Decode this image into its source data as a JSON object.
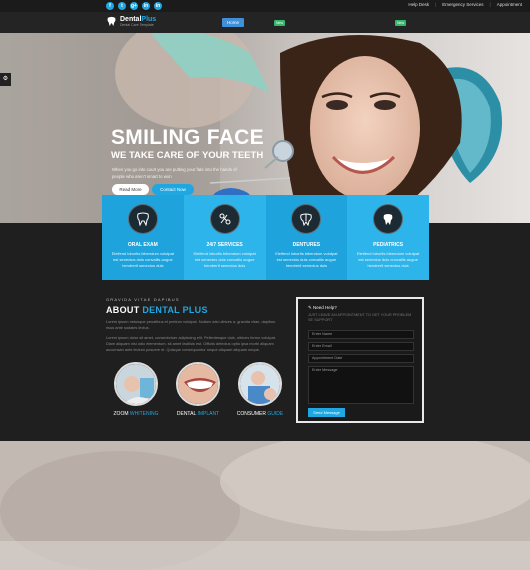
{
  "topbar": {
    "socials": [
      "f",
      "t",
      "g+",
      "in",
      "in"
    ],
    "links": [
      "Help Desk",
      "Emergency Services",
      "Appointment"
    ]
  },
  "brand": {
    "name_a": "Dental",
    "name_b": "Plus",
    "tagline": "Dental Care Template"
  },
  "nav": {
    "items": [
      "Home",
      "",
      "",
      "",
      "",
      "",
      ""
    ],
    "badges": [
      "New",
      "New"
    ]
  },
  "hero": {
    "side_button": "",
    "title": "SMILING FACE",
    "subtitle": "WE TAKE CARE OF YOUR TEETH",
    "description": "When you go into court you are putting your fate into the hands of people who aren't smart to won",
    "read_more": "Read More",
    "contact_now": "Contact Now"
  },
  "services": [
    {
      "title": "ORAL EXAM",
      "text": "Eleifend lobortis bibendum volutpat est senectus duis convallis augue hendrerit senectus duis"
    },
    {
      "title": "24/7 SERVICES",
      "text": "Eleifend lobortis bibendum volutpat est senectus duis convallis augue hendrerit senectus duis"
    },
    {
      "title": "DENTURES",
      "text": "Eleifend lobortis bibendum volutpat est senectus duis convallis augue hendrerit senectus duis"
    },
    {
      "title": "PEDIATRICS",
      "text": "Eleifend lobortis bibendum volutpat est senectus duis convallis augue hendrerit senectus duis"
    }
  ],
  "about": {
    "kicker": "GRAVIDA VITAE DAPIBUS",
    "title_a": "ABOUT ",
    "title_b": "DENTAL PLUS",
    "p1": "Lorem ipsum netusque penatibus et pretium volutpat. Nullam wisi ultrices a, gravida vitae, dapibus risus ante sodales lectus.",
    "p2": "Lorem ipsum dolor sit amet, consectetuer adipiscing elit. Pellentesque duis, ultrices fermo volutpat. Diam aliquam nisi odio elementum, sit amet facilisis est. Officiis delectus optio ipsa morbi aliquam accumsan ante lectum posuere et. Quisque consequuntur neque aliquam aliquam neque.",
    "features": [
      {
        "a": "ZOOM ",
        "b": "WHITENING"
      },
      {
        "a": "DENTAL ",
        "b": "IMPLANT"
      },
      {
        "a": "CONSUMER ",
        "b": "GUIDE"
      }
    ]
  },
  "form": {
    "heading": "Need Help?",
    "description": "JUST LEAVE AN APPOINTMENT TO GET YOUR PROBLEM SE SUPPORT",
    "name": "Enter Name",
    "email": "Enter Email",
    "date": "Appointment Date",
    "message": "Enter Message",
    "submit": "Send Message"
  },
  "colors": {
    "accent": "#1fa7e1",
    "dark": "#1f1f1f"
  }
}
